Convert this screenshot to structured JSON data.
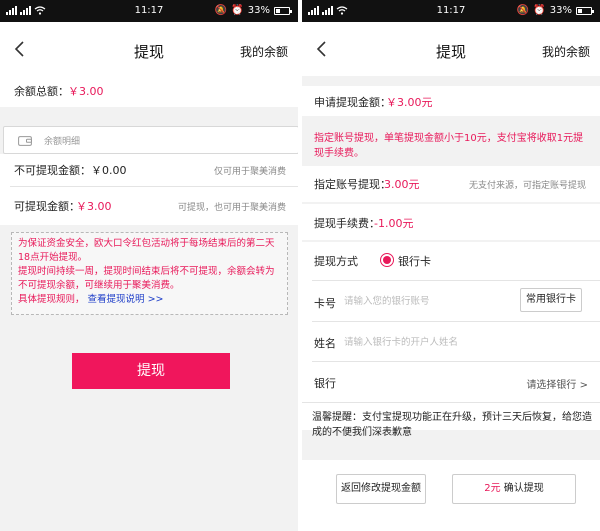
{
  "status_bar": {
    "time": "11:17",
    "battery": "33%",
    "battery_level": 0.33
  },
  "left": {
    "title": "提现",
    "right_link": "我的余额",
    "total_balance_label": "余额总额：",
    "total_balance_value": "￥3.00",
    "detail_label": "余额明细",
    "non_withdrawable_label": "不可提现金额：",
    "non_withdrawable_value": "￥0.00",
    "non_withdrawable_hint": "仅可用于聚美消费",
    "withdrawable_label": "可提现金额：",
    "withdrawable_value": "￥3.00",
    "withdrawable_hint": "可提现，也可用于聚美消费",
    "notice": {
      "line1": "为保证资金安全，欧大口令红包活动将于每场结束后的第二天18点开始提现。",
      "line2": "提现时间持续一周，提现时间结束后将不可提现，余额会转为不可提现余额，可继续用于聚美消费。",
      "rules_label": "具体提现规则，",
      "rules_link": "查看提现说明 >>"
    },
    "submit_label": "提现"
  },
  "right": {
    "title": "提现",
    "right_link": "我的余额",
    "apply_amount_label": "申请提现金额：",
    "apply_amount_value": "￥3.00元",
    "fee_notice": "指定账号提现，单笔提现金额小于10元，支付宝将收取1元提现手续费。",
    "designated_label": "指定账号提现：",
    "designated_value": "3.00元",
    "designated_hint": "无支付来源，可指定账号提现",
    "fee_label": "提现手续费：",
    "fee_value": "-1.00元",
    "method_label": "提现方式",
    "method_option": "银行卡",
    "card_label": "卡号",
    "card_placeholder": "请输入您的银行账号",
    "common_card_button": "常用银行卡",
    "name_label": "姓名",
    "name_placeholder": "请输入银行卡的开户人姓名",
    "bank_label": "银行",
    "bank_select": "请选择银行 >",
    "tip": "温馨提醒：支付宝提现功能正在升级，预计三天后恢复，给您造成的不便我们深表歉意",
    "back_button": "返回修改提现金额",
    "confirm_amount": "2元",
    "confirm_label": " 确认提现"
  },
  "colors": {
    "accent": "#e8195a",
    "link": "#1e3ec8"
  }
}
